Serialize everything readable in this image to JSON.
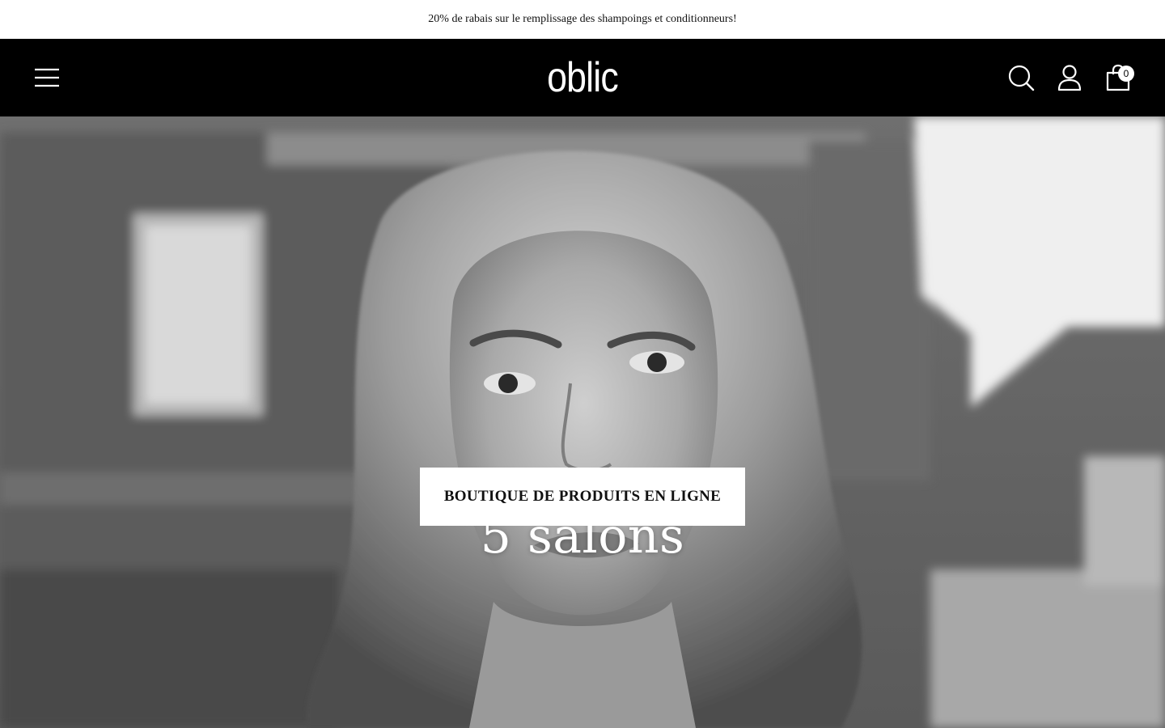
{
  "announcement": {
    "text": "20% de rabais sur le remplissage des shampoings et conditionneurs!"
  },
  "header": {
    "logo_text": "oblic",
    "menu_icon": "hamburger-menu-icon",
    "search_icon": "search-icon",
    "account_icon": "user-icon",
    "cart_icon": "shopping-bag-icon",
    "cart_count": "0"
  },
  "hero": {
    "title": "5 salons",
    "cta_label": "BOUTIQUE DE PRODUITS EN LIGNE"
  },
  "colors": {
    "header_bg": "#000000",
    "announcement_bg": "#ffffff",
    "cta_bg": "#ffffff",
    "text_on_hero": "#ffffff"
  }
}
